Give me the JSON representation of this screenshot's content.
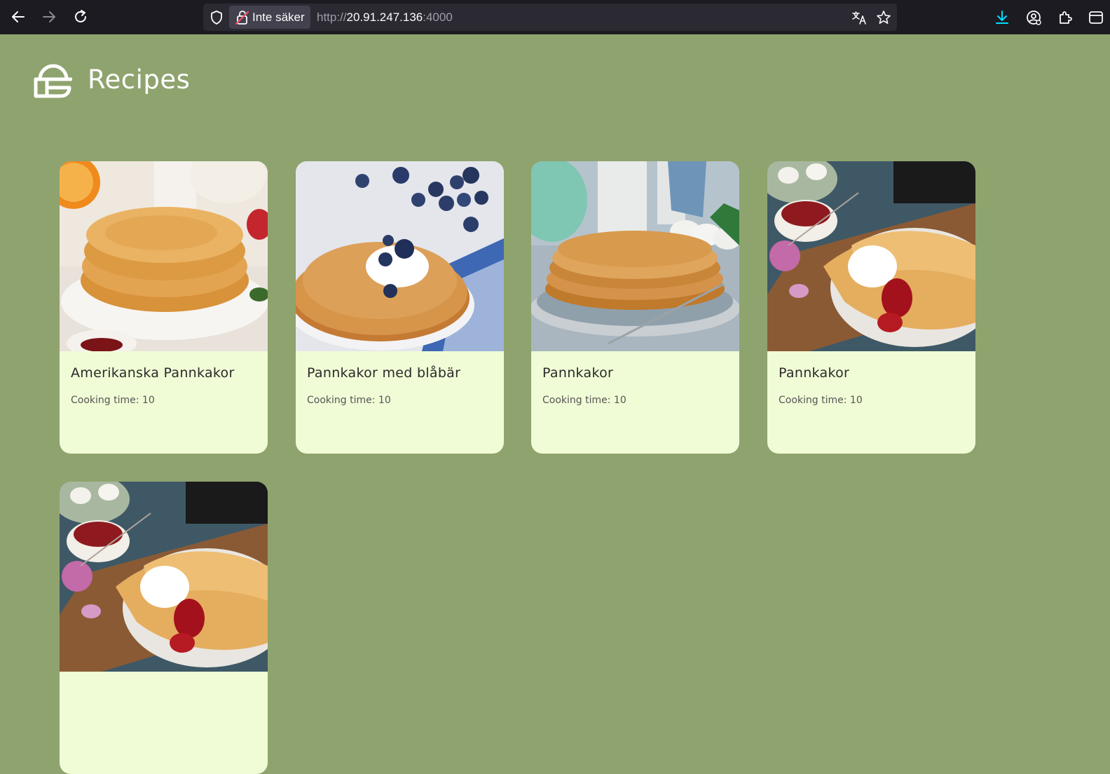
{
  "browser": {
    "security_label": "Inte säker",
    "url_scheme": "http://",
    "url_host": "20.91.247.136",
    "url_port": ":4000"
  },
  "header": {
    "title": "Recipes"
  },
  "recipes": [
    {
      "title": "Amerikanska Pannkakor",
      "cooking_time": "Cooking time: 10"
    },
    {
      "title": "Pannkakor med blåbär",
      "cooking_time": "Cooking time: 10"
    },
    {
      "title": "Pannkakor",
      "cooking_time": "Cooking time: 10"
    },
    {
      "title": "Pannkakor",
      "cooking_time": "Cooking time: 10"
    },
    {
      "title": "",
      "cooking_time": ""
    }
  ],
  "colors": {
    "page_background": "#8fa36e",
    "card_background": "#f0fcd6",
    "chrome_background": "#1c1b22"
  }
}
